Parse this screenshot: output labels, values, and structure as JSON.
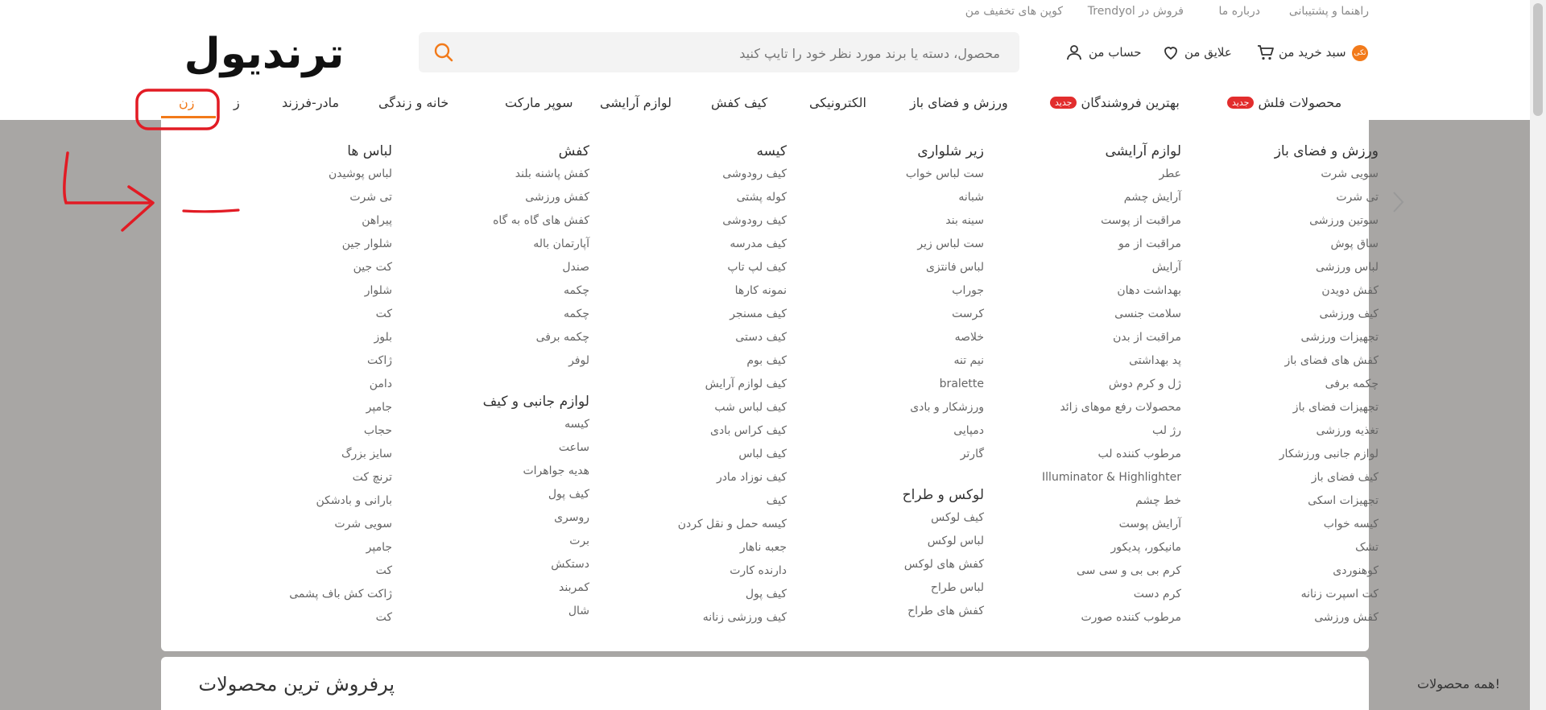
{
  "top_links": [
    "راهنما و پشتیبانی",
    "درباره ما",
    "Trendyol فروش در",
    "کوپن های تخفیف من"
  ],
  "logo_text": "ترندیول",
  "search": {
    "placeholder": "محصول، دسته یا برند مورد نظر خود را تایپ کنید"
  },
  "header_actions": {
    "cart": "سبد خرید من",
    "favorites": "علایق من",
    "account": "حساب من",
    "cart_badge": "تکی"
  },
  "nav": {
    "new_badge": "جدید",
    "items": [
      "محصولات فلش",
      "بهترین فروشندگان",
      "ورزش و فضای باز",
      "الکترونیکی",
      "کیف کفش",
      "لوازم آرایشی",
      "سوپر مارکت",
      "خانه و زندگی",
      "مادر-فرزند",
      "ز",
      "زن"
    ]
  },
  "columns": [
    {
      "title": "لباس ها",
      "items": [
        "لباس پوشیدن",
        "تی شرت",
        "پیراهن",
        "شلوار جین",
        "کت جین",
        "شلوار",
        "کت",
        "بلوز",
        "ژاکت",
        "دامن",
        "جامپر",
        "حجاب",
        "سایز بزرگ",
        "ترنچ کت",
        "بارانی و بادشکن",
        "سویی شرت",
        "جامپر",
        "کت",
        "ژاکت کش باف پشمی",
        "کت"
      ]
    },
    {
      "title": "کفش",
      "items": [
        "کفش پاشنه بلند",
        "کفش ورزشی",
        "کفش های گاه به گاه",
        "آپارتمان باله",
        "صندل",
        "چکمه",
        "چکمه",
        "چکمه برفی",
        "لوفر"
      ],
      "title2": "لوازم جانبی و کیف",
      "items2": [
        "کیسه",
        "ساعت",
        "هدیه جواهرات",
        "کیف پول",
        "روسری",
        "برت",
        "دستکش",
        "کمربند",
        "شال"
      ]
    },
    {
      "title": "کیسه",
      "items": [
        "کیف رودوشی",
        "کوله پشتی",
        "کیف رودوشی",
        "کیف مدرسه",
        "کیف لپ تاپ",
        "نمونه کارها",
        "کیف مسنجر",
        "کیف دستی",
        "کیف بوم",
        "کیف لوازم آرایش",
        "کیف لباس شب",
        "کیف کراس بادی",
        "کیف لباس",
        "کیف نوزاد مادر",
        "کیف",
        "کیسه حمل و نقل کردن",
        "جعبه ناهار",
        "دارنده کارت",
        "کیف پول",
        "کیف ورزشی زنانه"
      ]
    },
    {
      "title": "زیر شلواری",
      "items": [
        "ست لباس خواب",
        "شبانه",
        "سینه بند",
        "ست لباس زیر",
        "لباس فانتزی",
        "جوراب",
        "کرست",
        "خلاصه",
        "نیم تنه",
        "bralette",
        "ورزشکار و بادی",
        "دمپایی",
        "گارتر"
      ],
      "title2": "لوکس و طراح",
      "items2": [
        "کیف لوکس",
        "لباس لوکس",
        "کفش های لوکس",
        "لباس طراح",
        "کفش های طراح"
      ]
    },
    {
      "title": "لوازم آرایشی",
      "items": [
        "عطر",
        "آرایش چشم",
        "مراقبت از پوست",
        "مراقبت از مو",
        "آرایش",
        "بهداشت دهان",
        "سلامت جنسی",
        "مراقبت از بدن",
        "پد بهداشتی",
        "ژل و کرم دوش",
        "محصولات رفع موهای زائد",
        "رژ لب",
        "مرطوب کننده لب",
        "Illuminator & Highlighter",
        "خط چشم",
        "آرایش پوست",
        "مانیکور، پدیکور",
        "کرم بی بی و سی سی",
        "کرم دست",
        "مرطوب کننده صورت"
      ]
    },
    {
      "title": "ورزش و فضای باز",
      "items": [
        "سویی شرت",
        "تی شرت",
        "سوتین ورزشی",
        "ساق پوش",
        "لباس ورزشی",
        "کفش دویدن",
        "کیف ورزشی",
        "تجهیزات ورزشی",
        "کفش های فضای باز",
        "چکمه برفی",
        "تجهیزات فضای باز",
        "تغذیه ورزشی",
        "لوازم جانبی ورزشکار",
        "کیف فضای باز",
        "تجهیزات اسکی",
        "کیسه خواب",
        "تشک",
        "کوهنوردی",
        "کت اسپرت زنانه",
        "کفش ورزشی"
      ]
    }
  ],
  "bottom": {
    "title": "پرفروش ترین محصولات",
    "link": "همه محصولات!"
  },
  "colors": {
    "accent": "#f27a1a",
    "new_badge": "#e22d2d",
    "annotation": "#e21b24",
    "overlay": "#a8a6a4"
  }
}
